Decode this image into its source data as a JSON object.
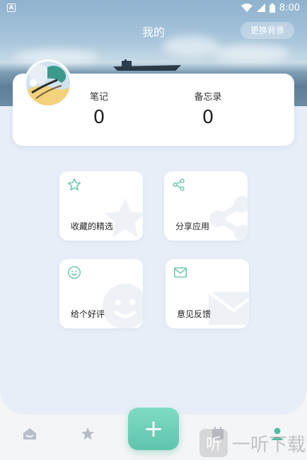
{
  "status_bar": {
    "time": "8:00",
    "app_icon_letter": "A"
  },
  "header": {
    "title": "我的",
    "change_bg_label": "更换背景"
  },
  "stats": [
    {
      "label": "笔记",
      "value": "0"
    },
    {
      "label": "备忘录",
      "value": "0"
    }
  ],
  "tiles": {
    "favorites": {
      "label": "收藏的精选",
      "icon": "star-icon"
    },
    "share": {
      "label": "分享应用",
      "icon": "share-icon"
    },
    "rate": {
      "label": "给个好评",
      "icon": "smile-icon"
    },
    "feedback": {
      "label": "意见反馈",
      "icon": "mail-icon"
    }
  },
  "nav": {
    "items": [
      "home-icon",
      "star-icon",
      "plus-icon",
      "calendar-icon",
      "user-icon"
    ],
    "fab_label": "+"
  },
  "watermark": {
    "text": "一听下载",
    "logo_char": "听"
  },
  "colors": {
    "accent": "#5fc4ac",
    "panel": "#e7eef7",
    "active_nav": "#4fbfa3",
    "inactive_nav": "#b8bec8"
  }
}
